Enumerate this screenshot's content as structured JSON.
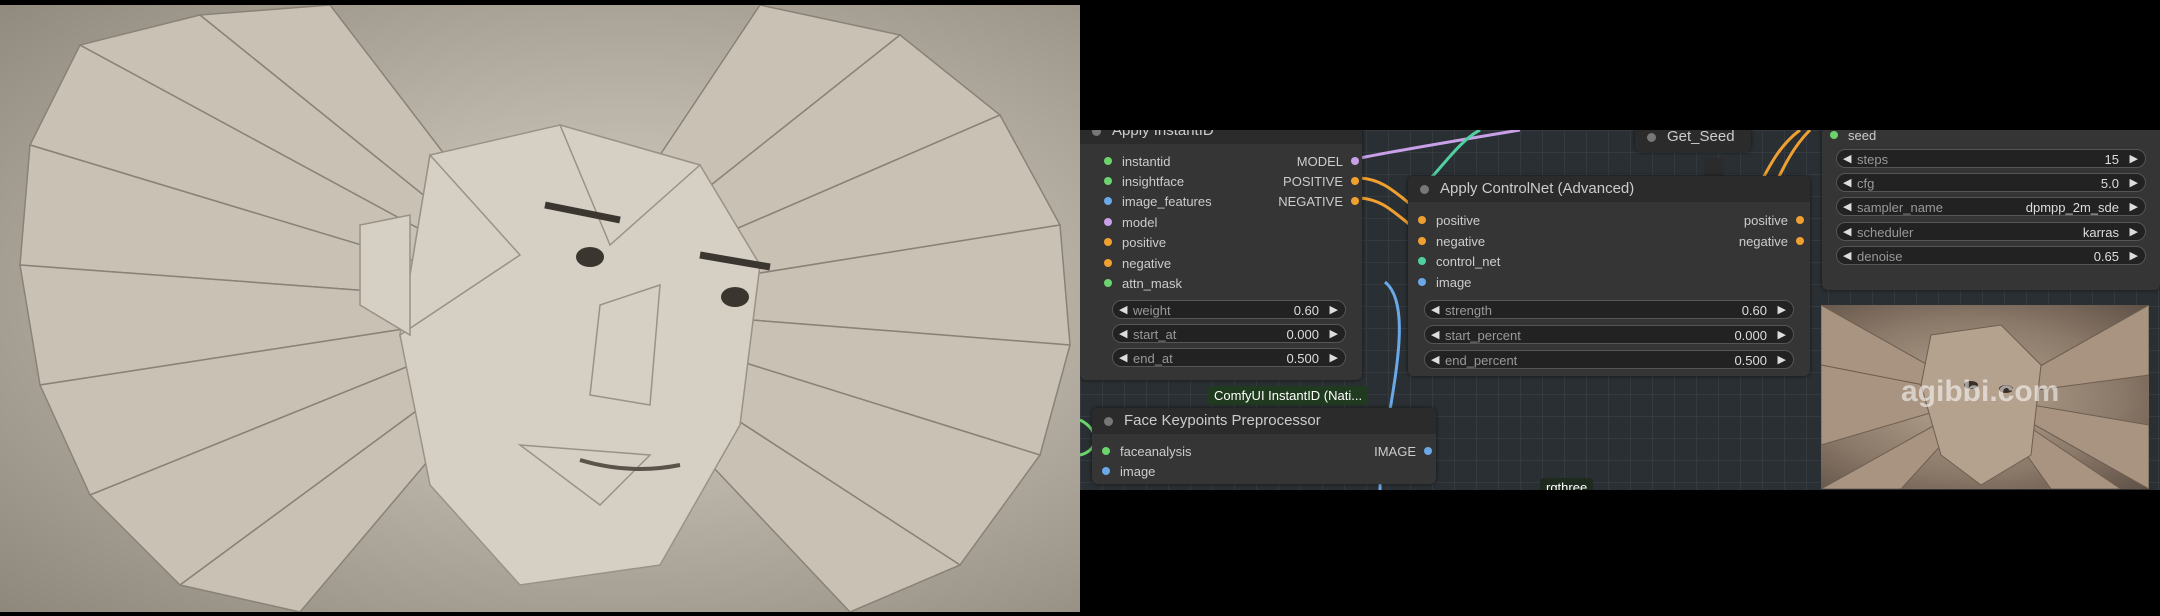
{
  "nodes": {
    "apply_instantid": {
      "title": "Apply InstantID",
      "inputs": [
        "instantid",
        "insightface",
        "image_features",
        "model",
        "positive",
        "negative",
        "attn_mask"
      ],
      "outputs": [
        "MODEL",
        "POSITIVE",
        "NEGATIVE"
      ],
      "widgets": [
        {
          "label": "weight",
          "value": "0.60"
        },
        {
          "label": "start_at",
          "value": "0.000"
        },
        {
          "label": "end_at",
          "value": "0.500"
        }
      ]
    },
    "get_seed": {
      "title": "Get_Seed"
    },
    "apply_controlnet": {
      "title": "Apply ControlNet (Advanced)",
      "inputs": [
        "positive",
        "negative",
        "control_net",
        "image"
      ],
      "outputs": [
        "positive",
        "negative"
      ],
      "widgets": [
        {
          "label": "strength",
          "value": "0.60"
        },
        {
          "label": "start_percent",
          "value": "0.000"
        },
        {
          "label": "end_percent",
          "value": "0.500"
        }
      ]
    },
    "ksampler": {
      "inputs": [
        "seed"
      ],
      "widgets": [
        {
          "label": "steps",
          "value": "15"
        },
        {
          "label": "cfg",
          "value": "5.0"
        },
        {
          "label": "sampler_name",
          "value": "dpmpp_2m_sde"
        },
        {
          "label": "scheduler",
          "value": "karras"
        },
        {
          "label": "denoise",
          "value": "0.65"
        }
      ]
    },
    "face_keypoints": {
      "title": "Face Keypoints Preprocessor",
      "inputs": [
        "faceanalysis",
        "image"
      ],
      "outputs": [
        "IMAGE"
      ]
    }
  },
  "badges": {
    "instantid_group": "ComfyUI InstantID (Nati...",
    "rgthree": "rgthree"
  },
  "preview": {
    "watermark": "agibbi.com"
  },
  "colors": {
    "green": "#6cd46c",
    "orange": "#f0a030",
    "purple": "#c9a0e8",
    "blue": "#6aa8e8",
    "teal": "#50d0a0"
  }
}
